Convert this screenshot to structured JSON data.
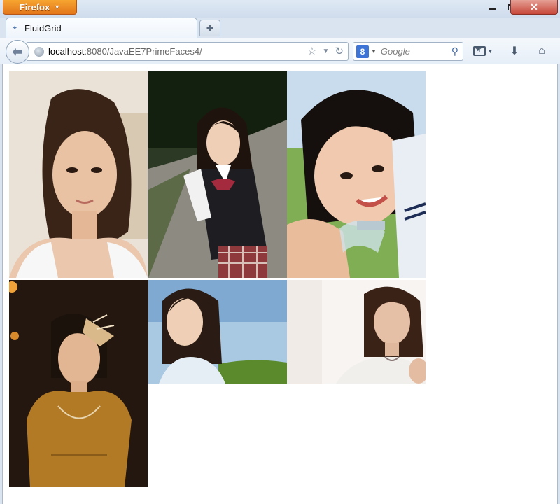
{
  "firefox_menu": {
    "label": "Firefox"
  },
  "window_controls": {
    "close": "✕"
  },
  "tab": {
    "title": "FluidGrid",
    "new_tab": "+"
  },
  "address": {
    "host": "localhost",
    "rest": ":8080/JavaEE7PrimeFaces4/"
  },
  "search": {
    "engine": "8",
    "placeholder": "Google"
  },
  "gallery": {
    "images": [
      {
        "name": "portrait-1"
      },
      {
        "name": "portrait-2"
      },
      {
        "name": "portrait-3"
      },
      {
        "name": "portrait-4"
      },
      {
        "name": "portrait-5"
      },
      {
        "name": "portrait-6"
      }
    ]
  }
}
